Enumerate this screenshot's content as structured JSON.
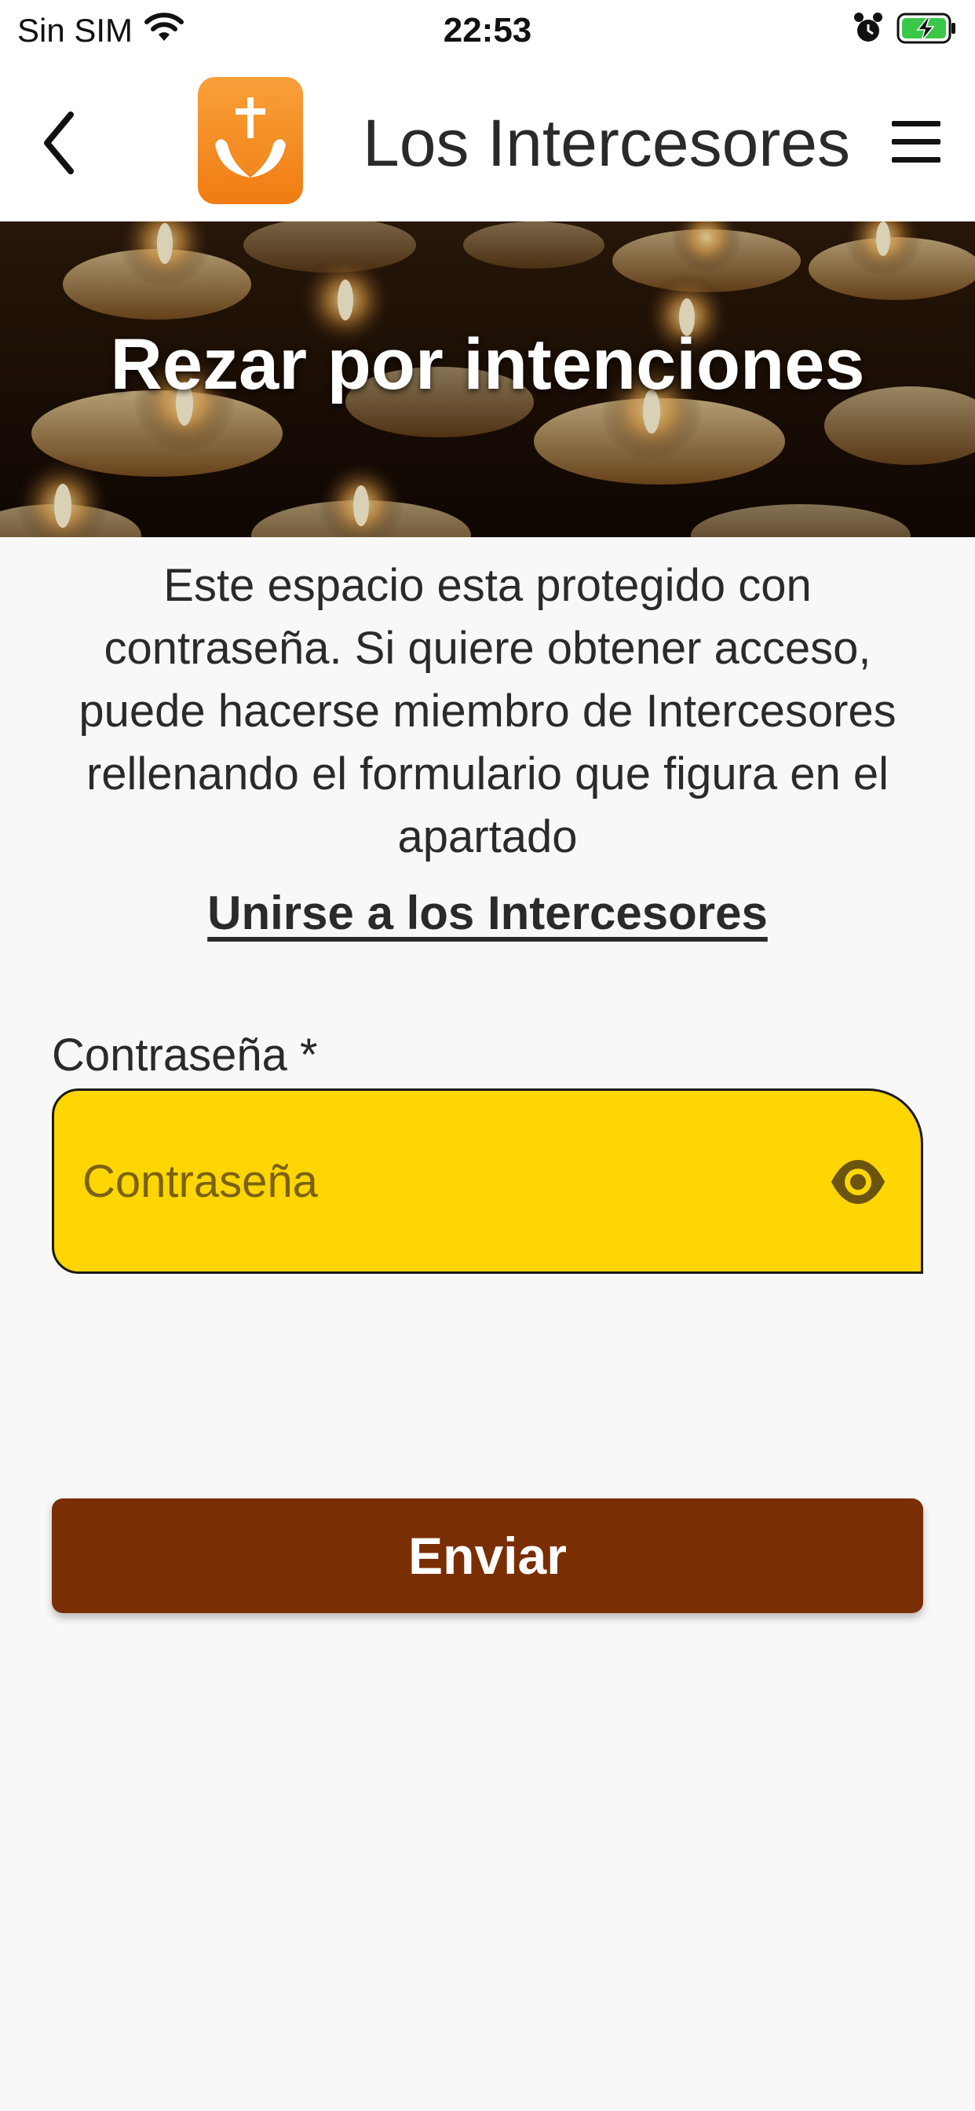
{
  "status_bar": {
    "carrier": "Sin SIM",
    "time": "22:53"
  },
  "header": {
    "title": "Los Intercesores",
    "back_icon": "chevron-left-icon",
    "menu_icon": "hamburger-menu-icon",
    "logo_icon": "cross-praying-hands-icon"
  },
  "hero": {
    "title": "Rezar por intenciones"
  },
  "intro": {
    "text": "Este espacio esta protegido con contraseña. Si quiere obtener acceso, puede hacerse miembro de Intercesores rellenando el formulario que figura en el apartado"
  },
  "join_link": {
    "label": "Unirse a los Intercesores"
  },
  "password": {
    "label": "Contraseña *",
    "placeholder": "Contraseña",
    "value": "",
    "toggle_icon": "eye-icon"
  },
  "submit": {
    "label": "Enviar"
  },
  "colors": {
    "field_background": "#ffd502",
    "button_background": "#7a2e04",
    "logo_orange": "#f39022"
  }
}
